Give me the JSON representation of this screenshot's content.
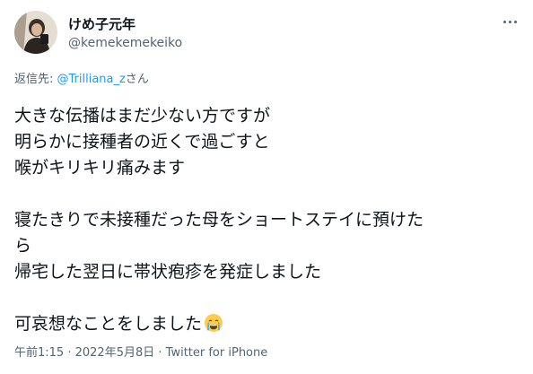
{
  "author": {
    "display_name": "けめ子元年",
    "handle": "@kemekemekeiko"
  },
  "reply_context": {
    "prefix": "返信先: ",
    "mention": "@Trilliana_z",
    "suffix": "さん"
  },
  "body": {
    "lines": [
      "大きな伝播はまだ少ない方ですが",
      "明らかに接種者の近くで過ごすと",
      "喉がキリキリ痛みます",
      "",
      "寝たきりで未接種だった母をショートステイに預けた",
      "ら",
      "帰宅した翌日に帯状疱疹を発症しました",
      "",
      "可哀想なことをしました"
    ],
    "emoji": "crying-face-emoji"
  },
  "meta": {
    "time": "午前1:15",
    "separator": " · ",
    "date": "2022年5月8日",
    "source": "Twitter for iPhone"
  },
  "icons": {
    "more": "more-options-icon",
    "avatar": "profile-avatar"
  },
  "colors": {
    "link": "#1d9bf0",
    "secondary_text": "#536471",
    "primary_text": "#0f1419"
  }
}
